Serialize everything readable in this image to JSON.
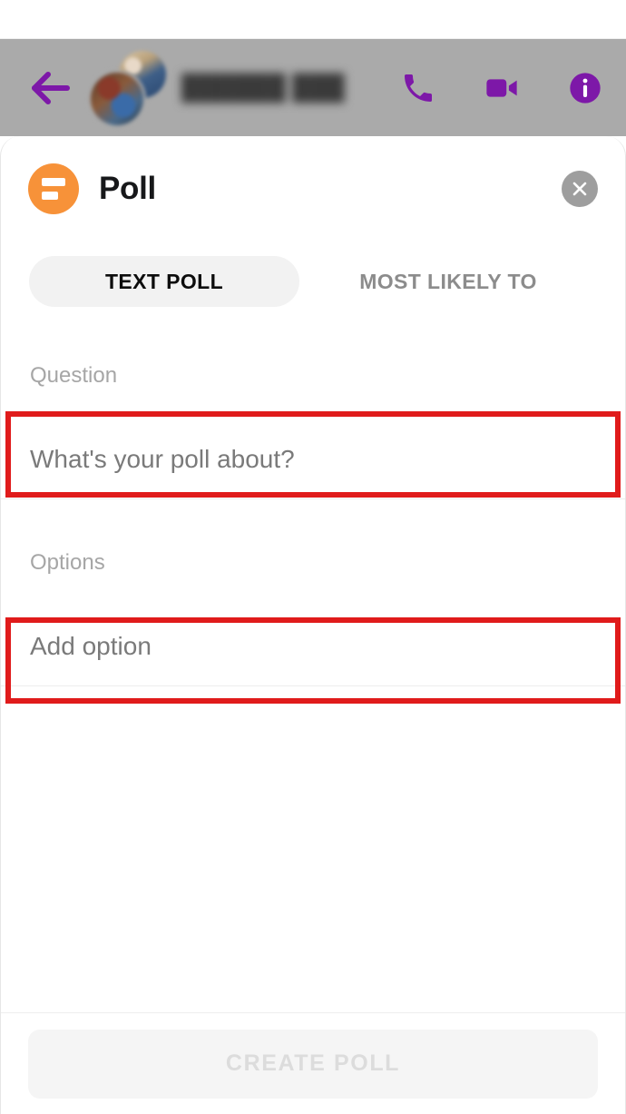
{
  "chat_header": {
    "back_icon": "back-arrow-icon",
    "title": "",
    "title_redacted": true,
    "actions": [
      {
        "name": "call-icon",
        "label": "Call"
      },
      {
        "name": "video-call-icon",
        "label": "Video call"
      },
      {
        "name": "info-icon",
        "label": "Info"
      }
    ],
    "accent_color": "#7d18a8",
    "overlay_color": "#aaaaaa"
  },
  "poll_sheet": {
    "badge_icon": "poll-bars-icon",
    "badge_color": "#f79239",
    "title": "Poll",
    "close_icon": "close-icon",
    "tabs": [
      {
        "label": "TEXT POLL",
        "active": true
      },
      {
        "label": "MOST LIKELY TO",
        "active": false
      }
    ],
    "question": {
      "label": "Question",
      "placeholder": "What's your poll about?",
      "value": ""
    },
    "options": {
      "label": "Options",
      "placeholder": "Add option",
      "value": ""
    },
    "create_button": {
      "label": "CREATE POLL",
      "enabled": false
    }
  },
  "annotations": {
    "color": "#e01b1b",
    "boxes": [
      {
        "name": "annotation-question",
        "target": "question-input"
      },
      {
        "name": "annotation-option",
        "target": "option-input"
      }
    ]
  }
}
